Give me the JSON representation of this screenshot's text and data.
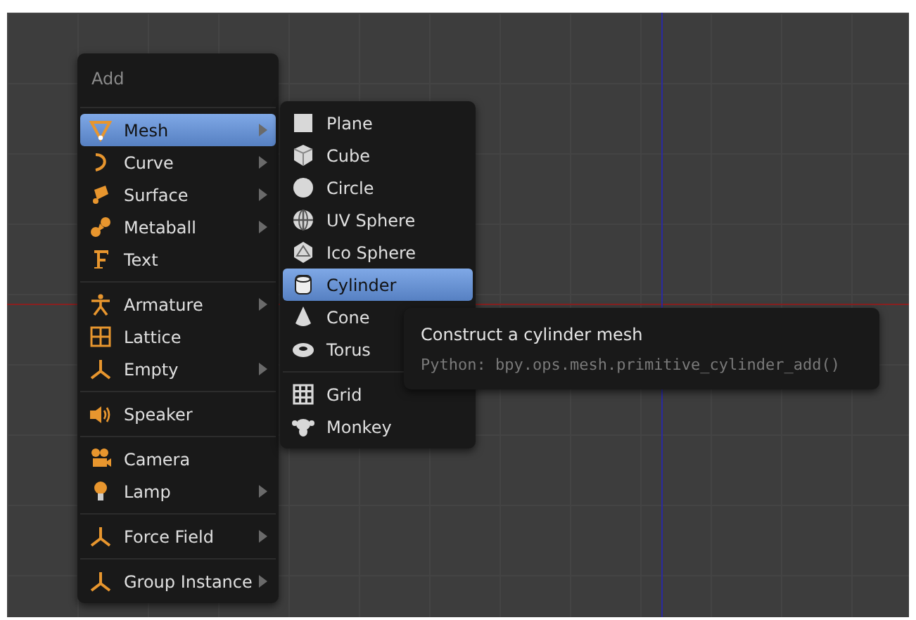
{
  "menu": {
    "title": "Add",
    "groups": [
      [
        {
          "label": "Mesh",
          "submenu": true,
          "selected": true
        },
        {
          "label": "Curve",
          "submenu": true,
          "selected": false
        },
        {
          "label": "Surface",
          "submenu": true,
          "selected": false
        },
        {
          "label": "Metaball",
          "submenu": true,
          "selected": false
        },
        {
          "label": "Text",
          "submenu": false,
          "selected": false
        }
      ],
      [
        {
          "label": "Armature",
          "submenu": true,
          "selected": false
        },
        {
          "label": "Lattice",
          "submenu": false,
          "selected": false
        },
        {
          "label": "Empty",
          "submenu": true,
          "selected": false
        }
      ],
      [
        {
          "label": "Speaker",
          "submenu": false,
          "selected": false
        }
      ],
      [
        {
          "label": "Camera",
          "submenu": false,
          "selected": false
        },
        {
          "label": "Lamp",
          "submenu": true,
          "selected": false
        }
      ],
      [
        {
          "label": "Force Field",
          "submenu": true,
          "selected": false
        }
      ],
      [
        {
          "label": "Group Instance",
          "submenu": true,
          "selected": false
        }
      ]
    ]
  },
  "submenu": {
    "groups": [
      [
        {
          "label": "Plane",
          "selected": false
        },
        {
          "label": "Cube",
          "selected": false
        },
        {
          "label": "Circle",
          "selected": false
        },
        {
          "label": "UV Sphere",
          "selected": false
        },
        {
          "label": "Ico Sphere",
          "selected": false
        },
        {
          "label": "Cylinder",
          "selected": true
        },
        {
          "label": "Cone",
          "selected": false
        },
        {
          "label": "Torus",
          "selected": false
        }
      ],
      [
        {
          "label": "Grid",
          "selected": false
        },
        {
          "label": "Monkey",
          "selected": false
        }
      ]
    ]
  },
  "tooltip": {
    "title": "Construct a cylinder mesh",
    "python": "Python: bpy.ops.mesh.primitive_cylinder_add()"
  }
}
